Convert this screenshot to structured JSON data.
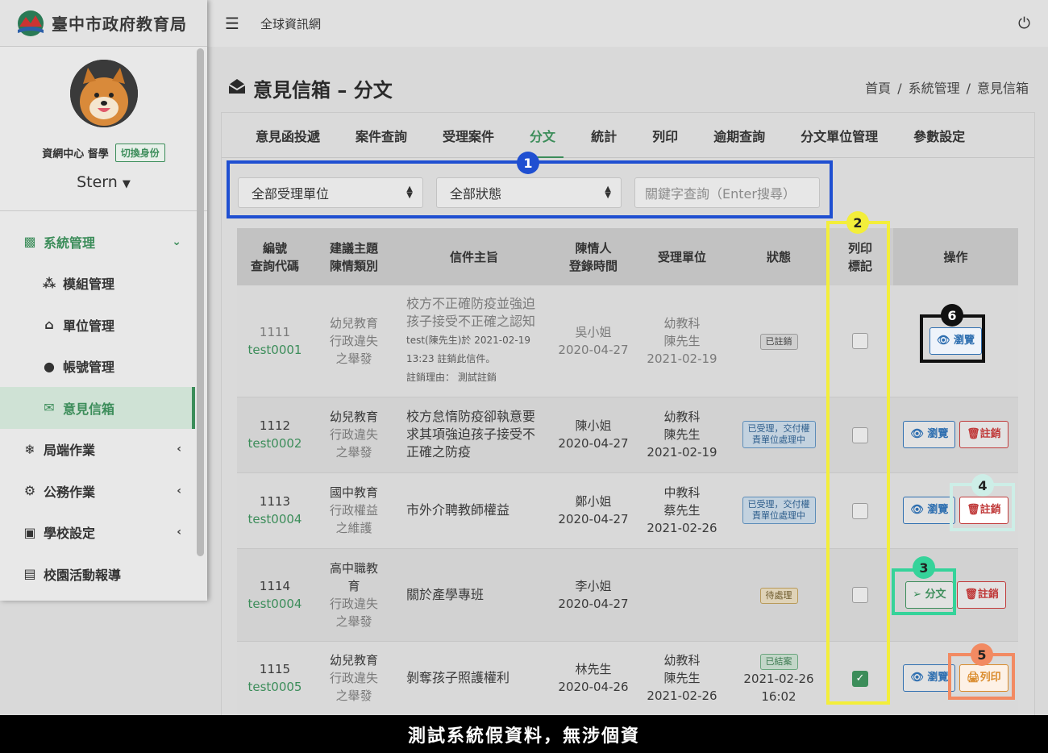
{
  "brand": {
    "title": "臺中市政府教育局"
  },
  "user": {
    "role": "資網中心 督學",
    "switch_label": "切換身份",
    "name": "Stern"
  },
  "sidebar": {
    "items": [
      {
        "label": "系統管理",
        "icon": "grid-icon"
      },
      {
        "label": "模組管理",
        "icon": "cubes-icon"
      },
      {
        "label": "單位管理",
        "icon": "bank-icon"
      },
      {
        "label": "帳號管理",
        "icon": "user-icon"
      },
      {
        "label": "意見信箱",
        "icon": "envelope-open-icon"
      },
      {
        "label": "局端作業",
        "icon": "snowflake-icon"
      },
      {
        "label": "公務作業",
        "icon": "cogs-icon"
      },
      {
        "label": "學校設定",
        "icon": "building-icon"
      },
      {
        "label": "校園活動報導",
        "icon": "newspaper-icon"
      }
    ]
  },
  "topbar": {
    "link": "全球資訊網"
  },
  "page": {
    "title": "意見信箱 – 分文"
  },
  "breadcrumb": [
    "首頁",
    "系統管理",
    "意見信箱"
  ],
  "tabs": [
    "意見函投遞",
    "案件查詢",
    "受理案件",
    "分文",
    "統計",
    "列印",
    "逾期查詢",
    "分文單位管理",
    "參數設定"
  ],
  "filters": {
    "unit": "全部受理單位",
    "status": "全部狀態",
    "keyword_placeholder": "關鍵字查詢（Enter搜尋）"
  },
  "table": {
    "headers": {
      "id1": "編號",
      "id2": "查詢代碼",
      "topic1": "建議主題",
      "topic2": "陳情類別",
      "subject": "信件主旨",
      "person1": "陳情人",
      "person2": "登錄時間",
      "unit": "受理單位",
      "status": "狀態",
      "print1": "列印",
      "print2": "標記",
      "ops": "操作"
    },
    "rows": [
      {
        "no": "1111",
        "code": "test0001",
        "topic": "幼兒教育",
        "cat1": "行政違失",
        "cat2": "之舉發",
        "subject1": "校方不正確防疫並強迫",
        "subject2": "孩子接受不正確之認知",
        "note1": "test(陳先生)於 2021-02-19",
        "note2": "13:23 註銷此信件。",
        "note3": "註銷理由： 測試註銷",
        "person": "吳小姐",
        "date": "2020-04-27",
        "unit": "幼教科",
        "officer": "陳先生",
        "unit_date": "2021-02-19",
        "status": "已註銷"
      },
      {
        "no": "1112",
        "code": "test0002",
        "topic": "幼兒教育",
        "cat1": "行政違失",
        "cat2": "之舉發",
        "subject1": "校方怠惰防疫卻執意要",
        "subject2": "求其項強迫孩子接受不",
        "subject3": "正確之防疫",
        "person": "陳小姐",
        "date": "2020-04-27",
        "unit": "幼教科",
        "officer": "陳先生",
        "unit_date": "2021-02-19",
        "status1": "已受理，交付權",
        "status2": "責單位處理中"
      },
      {
        "no": "1113",
        "code": "test0004",
        "topic": "國中教育",
        "cat1": "行政權益",
        "cat2": "之維護",
        "subject1": "市外介聘教師權益",
        "person": "鄭小姐",
        "date": "2020-04-27",
        "unit": "中教科",
        "officer": "蔡先生",
        "unit_date": "2021-02-26",
        "status1": "已受理，交付權",
        "status2": "責單位處理中"
      },
      {
        "no": "1114",
        "code": "test0004",
        "topic1": "高中職教",
        "topic2": "育",
        "cat1": "行政違失",
        "cat2": "之舉發",
        "subject1": "關於產學專班",
        "person": "李小姐",
        "date": "2020-04-27",
        "status": "待處理"
      },
      {
        "no": "1115",
        "code": "test0005",
        "topic": "幼兒教育",
        "cat1": "行政違失",
        "cat2": "之舉發",
        "subject1": "剝奪孩子照護權利",
        "person": "林先生",
        "date": "2020-04-26",
        "unit": "幼教科",
        "officer": "陳先生",
        "unit_date": "2021-02-26",
        "status": "已結案",
        "status_date": "2021-02-26",
        "status_time": "16:02"
      }
    ],
    "buttons": {
      "view": "瀏覽",
      "cancel": "註銷",
      "assign": "分文",
      "print": "列印"
    }
  },
  "annotations": [
    "1",
    "2",
    "3",
    "4",
    "5",
    "6"
  ],
  "footer": {
    "text": "測試系統假資料，無涉個資"
  },
  "colors": {
    "accent": "#3c8d5a",
    "ann1": "#1f4fd1",
    "ann2": "#f3ee3a",
    "ann3": "#35d39a",
    "ann4": "#cdeee7",
    "ann5": "#f28a62",
    "ann6": "#111111"
  }
}
